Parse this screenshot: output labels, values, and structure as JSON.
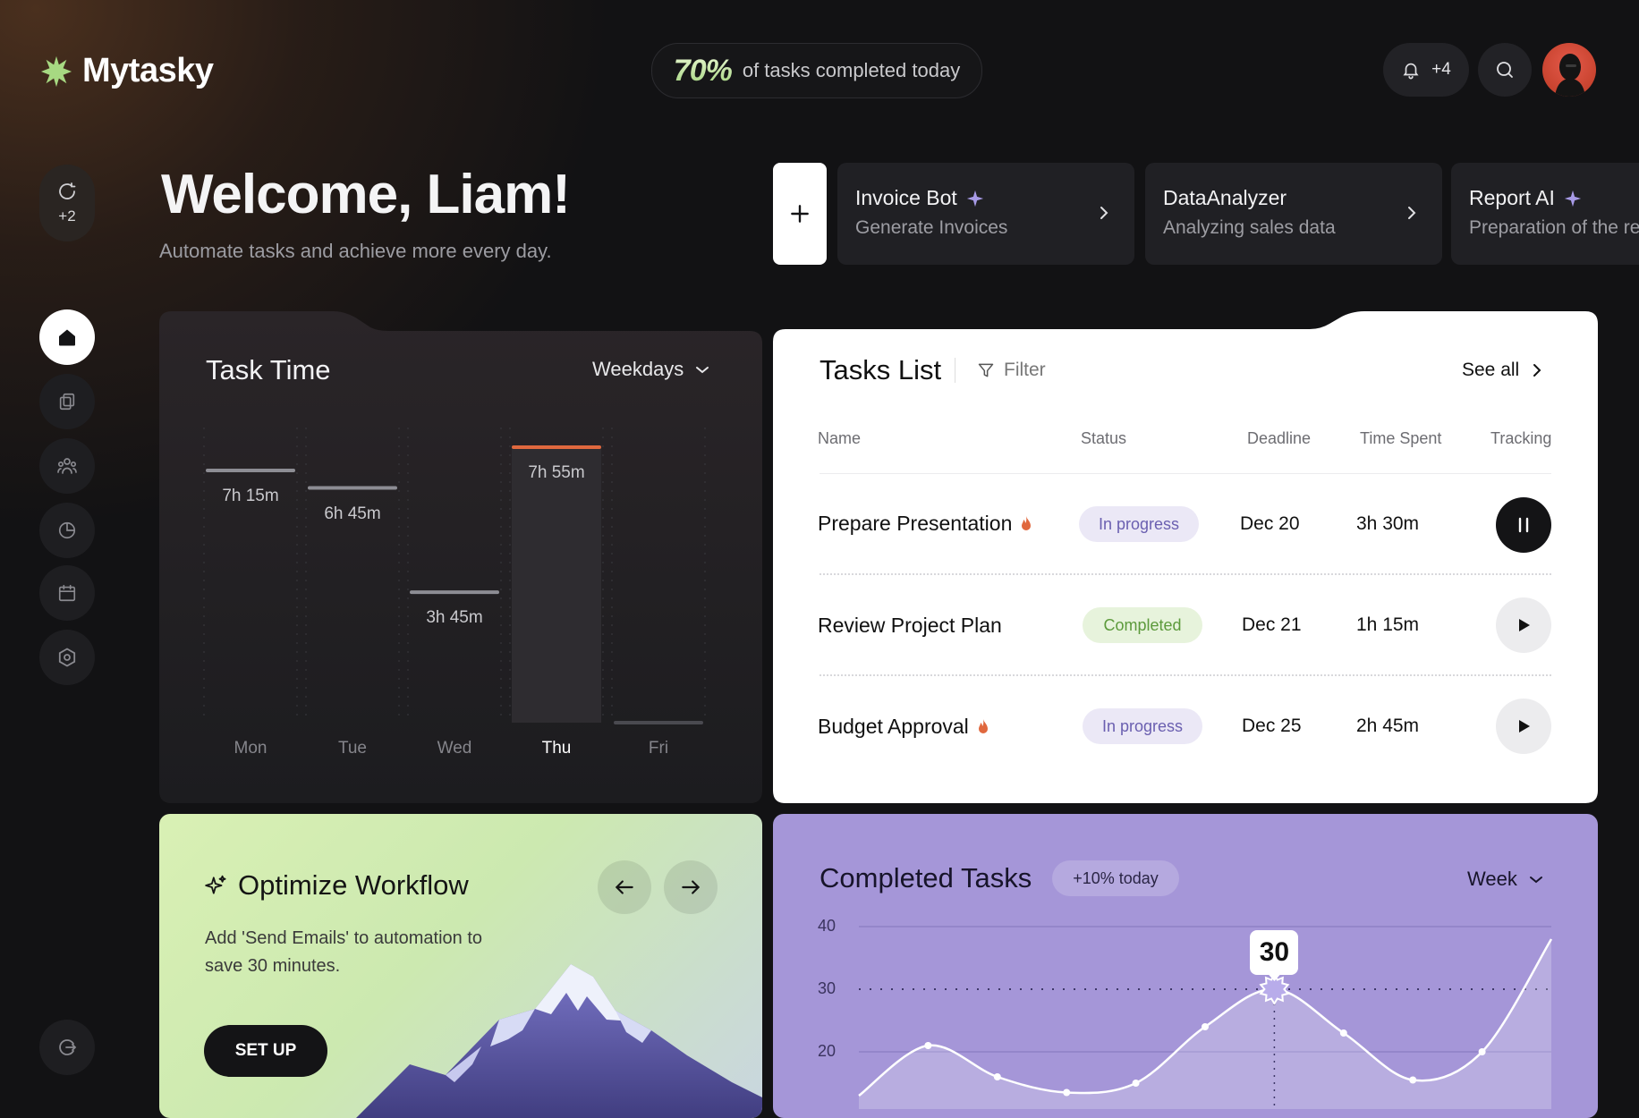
{
  "app": {
    "name": "Mytasky"
  },
  "header": {
    "progress_value": "70%",
    "progress_text": "of tasks completed today",
    "notifications_count": "+4"
  },
  "sidebar": {
    "refresh_count": "+2",
    "items": [
      {
        "name": "home",
        "icon": "home-icon",
        "active": true
      },
      {
        "name": "copy",
        "icon": "copy-icon",
        "active": false
      },
      {
        "name": "team",
        "icon": "team-icon",
        "active": false
      },
      {
        "name": "reports",
        "icon": "pie-chart-icon",
        "active": false
      },
      {
        "name": "calendar",
        "icon": "calendar-icon",
        "active": false
      },
      {
        "name": "settings",
        "icon": "settings-icon",
        "active": false
      }
    ]
  },
  "welcome": {
    "title": "Welcome, Liam!",
    "subtitle": "Automate tasks and achieve more every day."
  },
  "bots": [
    {
      "name": "Invoice Bot",
      "desc": "Generate Invoices",
      "sparkle": true
    },
    {
      "name": "DataAnalyzer",
      "desc": "Analyzing sales data",
      "sparkle": false
    },
    {
      "name": "Report AI",
      "desc": "Preparation of the re",
      "sparkle": true
    }
  ],
  "task_time": {
    "title": "Task Time",
    "range": "Weekdays",
    "days": [
      {
        "day": "Mon",
        "label": "7h 15m",
        "hours": 7.25
      },
      {
        "day": "Tue",
        "label": "6h 45m",
        "hours": 6.75
      },
      {
        "day": "Wed",
        "label": "3h 45m",
        "hours": 3.75
      },
      {
        "day": "Thu",
        "label": "7h 55m",
        "hours": 7.92,
        "active": true
      },
      {
        "day": "Fri",
        "label": "",
        "hours": 0
      }
    ]
  },
  "tasks_list": {
    "title": "Tasks List",
    "filter": "Filter",
    "see_all": "See all",
    "columns": [
      "Name",
      "Status",
      "Deadline",
      "Time Spent",
      "Tracking"
    ],
    "rows": [
      {
        "name": "Prepare Presentation",
        "hot": true,
        "status": "In progress",
        "deadline": "Dec 20",
        "time_spent": "3h 30m",
        "tracking": "pause"
      },
      {
        "name": "Review Project Plan",
        "hot": false,
        "status": "Completed",
        "deadline": "Dec 21",
        "time_spent": "1h 15m",
        "tracking": "play"
      },
      {
        "name": "Budget Approval",
        "hot": true,
        "status": "In progress",
        "deadline": "Dec 25",
        "time_spent": "2h 45m",
        "tracking": "play"
      }
    ]
  },
  "optimize": {
    "title": "Optimize Workflow",
    "desc": "Add 'Send Emails' to automation to save 30 minutes.",
    "button": "SET UP"
  },
  "completed_tasks": {
    "title": "Completed Tasks",
    "badge": "+10% today",
    "range": "Week",
    "peak_label": "30"
  },
  "chart_data": [
    {
      "type": "bar",
      "categories": [
        "Mon",
        "Tue",
        "Wed",
        "Thu",
        "Fri"
      ],
      "values": [
        7.25,
        6.75,
        3.75,
        7.92,
        0
      ],
      "labels": [
        "7h 15m",
        "6h 45m",
        "3h 45m",
        "7h 55m",
        ""
      ],
      "title": "Task Time",
      "ylim": [
        0,
        10
      ]
    },
    {
      "type": "area",
      "title": "Completed Tasks",
      "yticks": [
        40,
        30,
        20
      ],
      "ylim": [
        10,
        40
      ],
      "x": [
        0,
        1,
        2,
        3,
        4,
        5,
        6,
        7,
        8,
        9
      ],
      "values": [
        13,
        21,
        16,
        13.5,
        15,
        24,
        30,
        23,
        15.5,
        20,
        38
      ],
      "peak": 30
    }
  ],
  "colors": {
    "accent_green": "#a7d982",
    "accent_purple": "#a596d8",
    "highlight_orange": "#e0683e"
  }
}
